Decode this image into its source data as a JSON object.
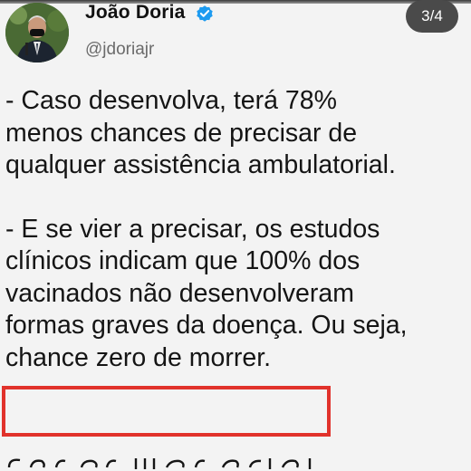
{
  "tweet": {
    "author_name": "João Doria",
    "handle": "@jdoriajr",
    "verified": true,
    "page_counter": "3/4",
    "lines": [
      "- Caso desenvolva, terá 78%",
      "menos chances de precisar de",
      "qualquer assistência ambulatorial.",
      "- E se vier a precisar, os estudos",
      "clínicos indicam que 100% dos",
      "vacinados não desenvolveram",
      "formas graves da doença. Ou seja,",
      "chance zero de morrer."
    ],
    "highlighted_line_index": 7
  },
  "colors": {
    "highlight_border": "#e1322b",
    "verified_badge": "#1d9bf0",
    "counter_bg": "#4a4a4a"
  },
  "icons": {
    "verified": "verified-badge-icon"
  }
}
